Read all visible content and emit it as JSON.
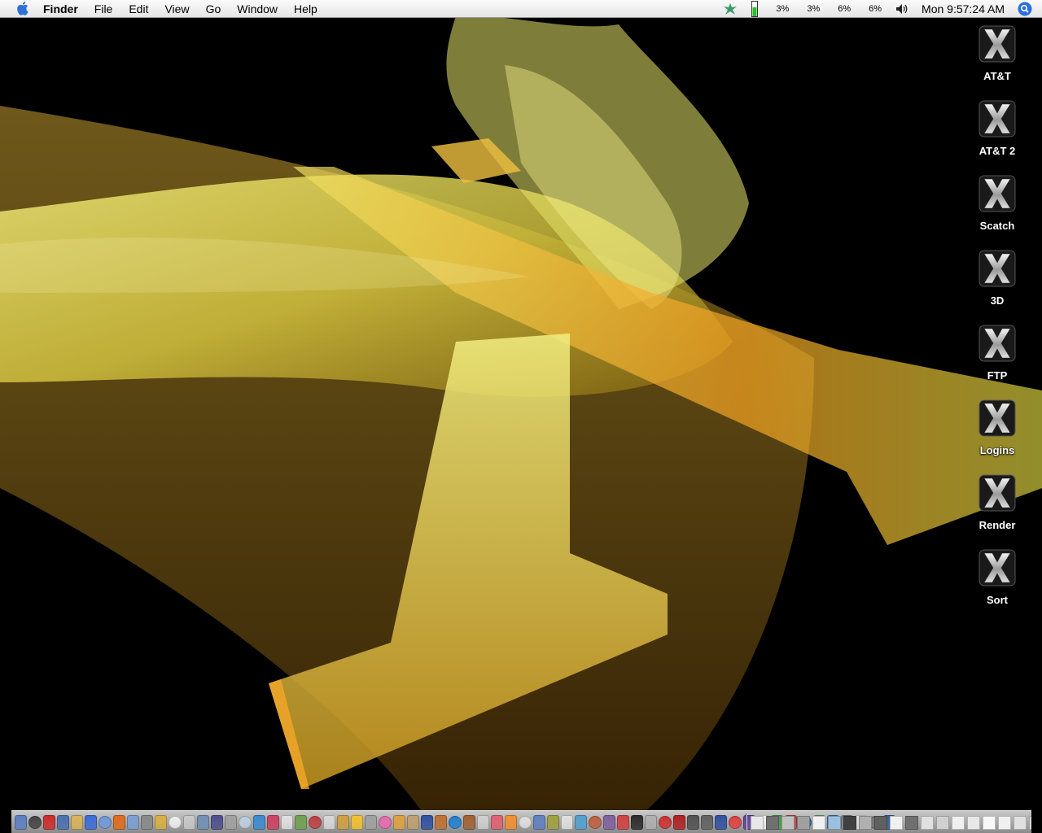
{
  "menubar": {
    "apple_icon": "apple-logo-icon",
    "app_name": "Finder",
    "menus": [
      "File",
      "Edit",
      "View",
      "Go",
      "Window",
      "Help"
    ],
    "cpu": [
      "3%",
      "3%",
      "6%",
      "6%"
    ],
    "clock": "Mon 9:57:24 AM",
    "extras": [
      "leaf-icon",
      "battery-meter-icon",
      "volume-icon",
      "spotlight-icon"
    ]
  },
  "desktop": {
    "icons": [
      {
        "label": "AT&T"
      },
      {
        "label": "AT&T 2"
      },
      {
        "label": "Scatch"
      },
      {
        "label": "3D"
      },
      {
        "label": "FTP"
      },
      {
        "label": "Logins"
      },
      {
        "label": "Render"
      },
      {
        "label": "Sort"
      }
    ],
    "icon_image": "tiger-x-icon",
    "colors": {
      "wallpaper_bg": "#000000",
      "ribbon": "#e8e25a",
      "ribbon_dark": "#c9a22a",
      "ribbon_orange": "#f2a01e"
    }
  },
  "dock": {
    "apps": [
      "#5b7fc4",
      "#444444",
      "#cc2a2a",
      "#4a6fb0",
      "#d9b35a",
      "#3d6bd6",
      "#6d9ad9",
      "#e06a1a",
      "#7a9fd0",
      "#888888",
      "#d8b040",
      "#f0f0f0",
      "#c8c8c8",
      "#6f8fb5",
      "#4d4d8f",
      "#a0a0a0",
      "#c0d0e0",
      "#3a8ad0",
      "#d04060",
      "#e0e0e0",
      "#70a050",
      "#c04040",
      "#d8d8d8",
      "#d0a040",
      "#f2c230",
      "#a0a0a0",
      "#e86ab0",
      "#e0a040",
      "#c0a070",
      "#3050a0",
      "#c07030",
      "#2080d0",
      "#a06030",
      "#d0d0d0",
      "#e06070",
      "#f09030",
      "#e0e0e0",
      "#6080c0",
      "#a0a040",
      "#e0e0e0",
      "#50a0d0",
      "#c06040",
      "#8060a0",
      "#d04040",
      "#2a2a2a",
      "#b0b0b0",
      "#d03030",
      "#b02020",
      "#505050",
      "#606060",
      "#3050a0",
      "#e04040",
      "#6040a0",
      "#f0f0f0",
      "#40a040",
      "#c04040",
      "#2060c0",
      "#50b060",
      "#3070c0",
      "#808080",
      "#e0e0e0",
      "#707070",
      "#3060a0"
    ],
    "docs": [
      "#e8e8e8",
      "#707070",
      "#c0c0c0",
      "#a0a0a0",
      "#f0f0f0",
      "#9ac0e0",
      "#404040",
      "#b0b0b0",
      "#606060",
      "#f0f0f0",
      "#707070",
      "#e0e0e0",
      "#d0d0d0",
      "#f0f0f0",
      "#e8e8e8",
      "#f8f8f8",
      "#f0f0f0",
      "#e0e0e0",
      "#d8d8d8",
      "#c0c0c0",
      "#e0e0e0"
    ],
    "trash_icon": "trash-icon"
  }
}
